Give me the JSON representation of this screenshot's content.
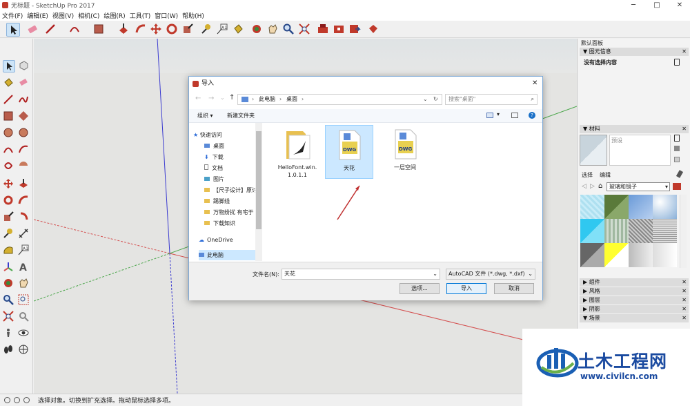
{
  "window": {
    "title": "无标题 - SketchUp Pro 2017",
    "min": "─",
    "max": "□",
    "close": "✕"
  },
  "menu": [
    "文件(F)",
    "编辑(E)",
    "视图(V)",
    "相机(C)",
    "绘图(R)",
    "工具(T)",
    "窗口(W)",
    "帮助(H)"
  ],
  "right_panel": {
    "tray_title": "默认面板",
    "entity_info": {
      "title": "图元信息",
      "status": "没有选择内容"
    },
    "materials": {
      "title": "材料",
      "preview_name": "预设",
      "tabs": [
        "选择",
        "编辑"
      ],
      "library": "玻璃和镜子"
    },
    "collapsed": [
      "组件",
      "风格",
      "图层",
      "阴影",
      "场景"
    ]
  },
  "status": {
    "text": "选择对象。切换到扩充选择。拖动鼠标选择多项。"
  },
  "dialog": {
    "title": "导入",
    "breadcrumb": [
      "此电脑",
      "桌面"
    ],
    "search_placeholder": "搜索\"桌面\"",
    "organize": "组织 ▾",
    "new_folder": "新建文件夹",
    "nav_items": [
      {
        "label": "快速访问",
        "pinned": false
      },
      {
        "label": "桌面",
        "pinned": true
      },
      {
        "label": "下载",
        "pinned": true
      },
      {
        "label": "文档",
        "pinned": true
      },
      {
        "label": "图片",
        "pinned": true
      },
      {
        "label": "【尺子设计】原讨",
        "pinned": false
      },
      {
        "label": "踢脚线",
        "pinned": false
      },
      {
        "label": "万物纷扰 有宅于",
        "pinned": false
      },
      {
        "label": "下载知识",
        "pinned": false
      },
      {
        "label": "OneDrive",
        "pinned": false
      },
      {
        "label": "此电脑",
        "pinned": false
      }
    ],
    "files": [
      {
        "name": "HelloFont.win.1.0.1.1",
        "type": "folder"
      },
      {
        "name": "天花",
        "type": "dwg"
      },
      {
        "name": "一层空间",
        "type": "dwg"
      }
    ],
    "dwg_badge": "DWG",
    "filename_label": "文件名(N):",
    "filename_value": "天花",
    "filetype": "AutoCAD 文件 (*.dwg, *.dxf)",
    "options_button": "选项...",
    "import_button": "导入",
    "cancel_button": "取消"
  },
  "watermark": {
    "brand": "土木工程网",
    "url": "www.civilcn.com"
  },
  "colors": {
    "accent": "#0078d7",
    "selection": "#cce8ff",
    "axis_red": "#d45050",
    "axis_green": "#4aa64a",
    "axis_blue": "#3a3ad0",
    "watermark_blue": "#1a5fb4"
  }
}
